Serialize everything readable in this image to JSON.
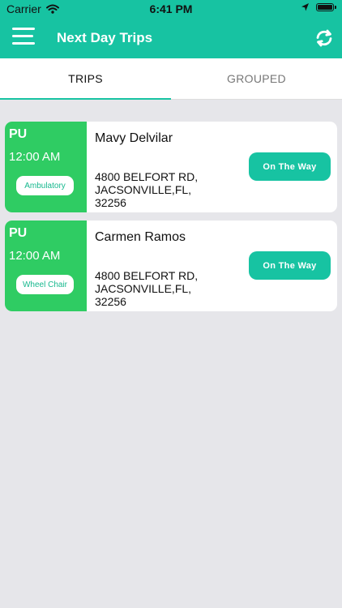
{
  "statusbar": {
    "carrier": "Carrier",
    "time": "6:41 PM"
  },
  "header": {
    "title": "Next Day Trips",
    "color": "#17c3a2",
    "menu_icon": "menu-icon",
    "refresh_icon": "refresh-icon"
  },
  "tabs": [
    {
      "label": "TRIPS",
      "active": true
    },
    {
      "label": "GROUPED",
      "active": false
    }
  ],
  "trips": [
    {
      "pickup_type": "PU",
      "time": "12:00 AM",
      "mobility": "Ambulatory",
      "name": "Mavy Delvilar",
      "address": {
        "line1": "4800 BELFORT RD,",
        "line2": "JACSONVILLE,FL,",
        "line3": "32256"
      },
      "status_button": "On The Way"
    },
    {
      "pickup_type": "PU",
      "time": "12:00 AM",
      "mobility": "Wheel Chair",
      "name": "Carmen Ramos",
      "address": {
        "line1": "4800 BELFORT RD,",
        "line2": "JACSONVILLE,FL,",
        "line3": "32256"
      },
      "status_button": "On The Way"
    }
  ],
  "colors": {
    "card_left": "#2fcc63",
    "button": "#17c3a2",
    "background": "#e6e6ea"
  }
}
